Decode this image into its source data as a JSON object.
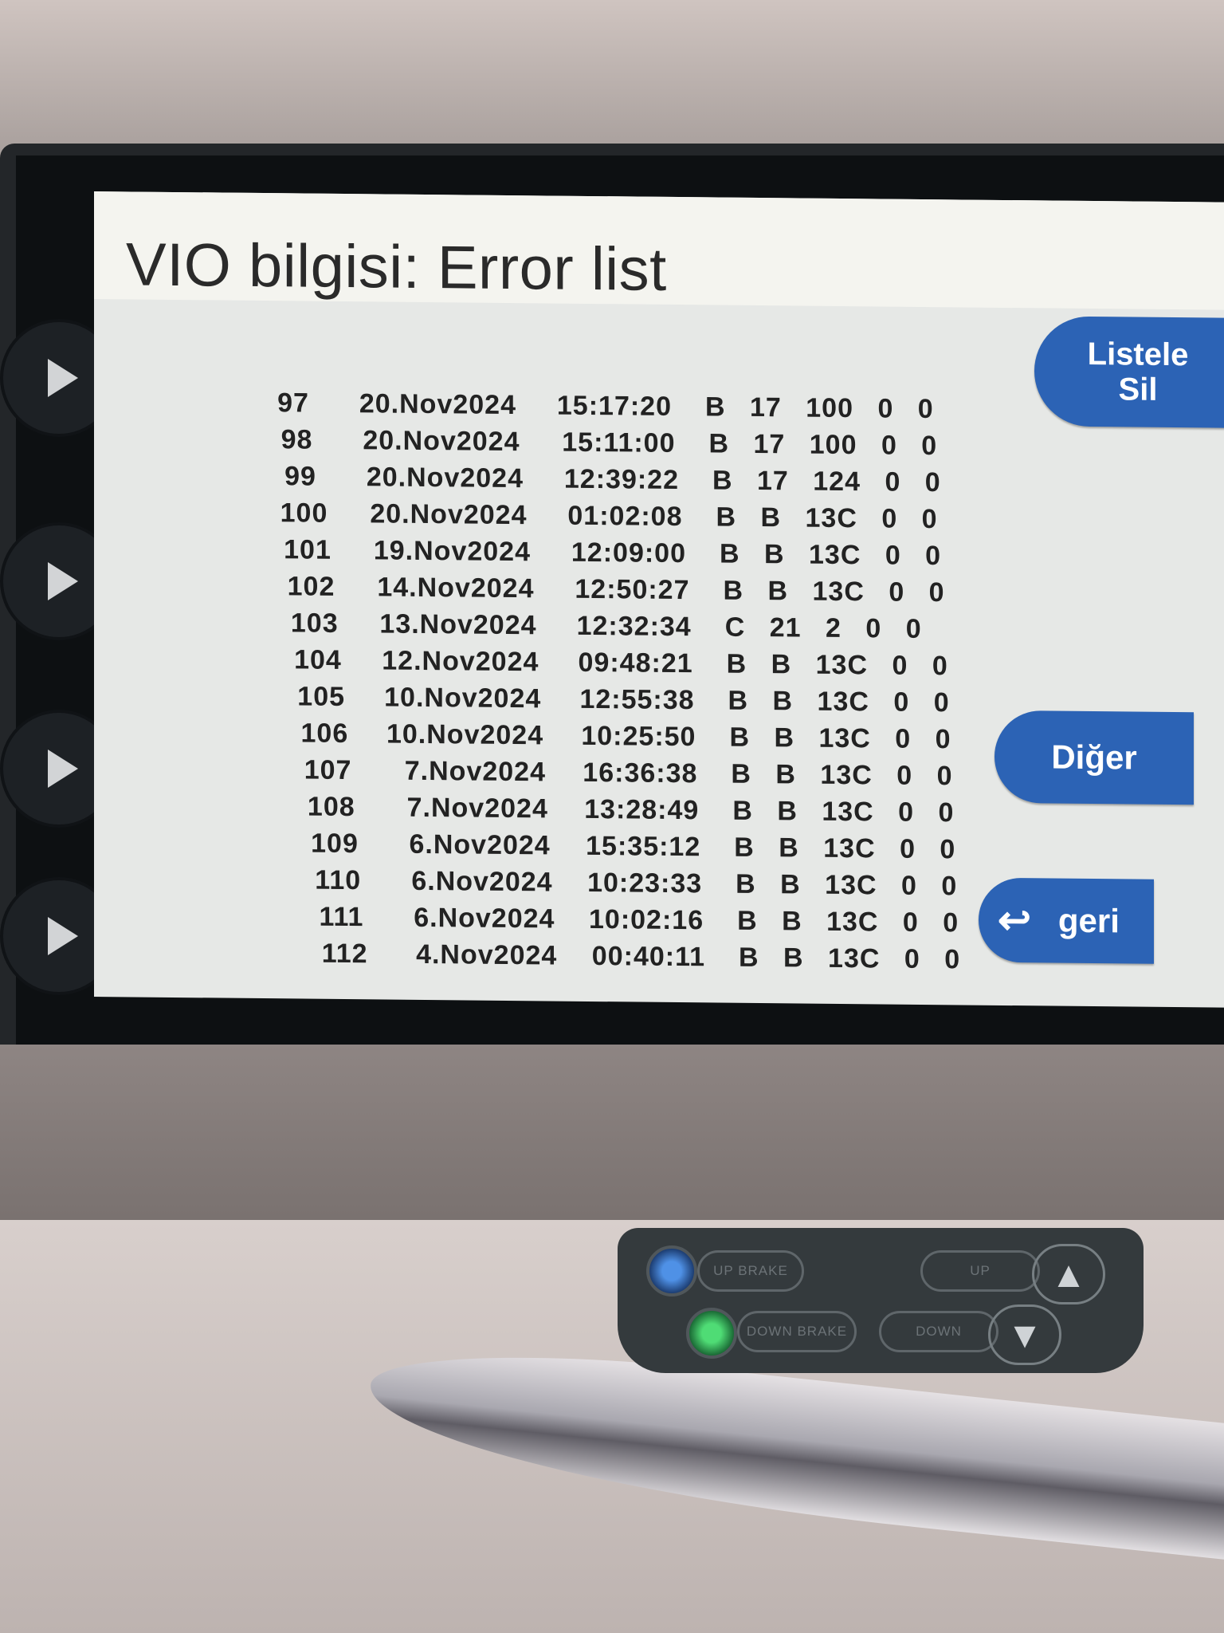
{
  "screen": {
    "title": "VIO bilgisi: Error list"
  },
  "error_list": [
    {
      "no": "97",
      "date": "20.Nov2024",
      "time": "15:17:20",
      "codes": "B 17 100 0 0"
    },
    {
      "no": "98",
      "date": "20.Nov2024",
      "time": "15:11:00",
      "codes": "B 17 100 0 0"
    },
    {
      "no": "99",
      "date": "20.Nov2024",
      "time": "12:39:22",
      "codes": "B 17 124 0 0"
    },
    {
      "no": "100",
      "date": "20.Nov2024",
      "time": "01:02:08",
      "codes": "B B 13C 0 0"
    },
    {
      "no": "101",
      "date": "19.Nov2024",
      "time": "12:09:00",
      "codes": "B B 13C 0 0"
    },
    {
      "no": "102",
      "date": "14.Nov2024",
      "time": "12:50:27",
      "codes": "B B 13C 0 0"
    },
    {
      "no": "103",
      "date": "13.Nov2024",
      "time": "12:32:34",
      "codes": "C 21 2 0 0"
    },
    {
      "no": "104",
      "date": "12.Nov2024",
      "time": "09:48:21",
      "codes": "B B 13C 0 0"
    },
    {
      "no": "105",
      "date": "10.Nov2024",
      "time": "12:55:38",
      "codes": "B B 13C 0 0"
    },
    {
      "no": "106",
      "date": "10.Nov2024",
      "time": "10:25:50",
      "codes": "B B 13C 0 0"
    },
    {
      "no": "107",
      "date": "7.Nov2024",
      "time": "16:36:38",
      "codes": "B B 13C 0 0"
    },
    {
      "no": "108",
      "date": "7.Nov2024",
      "time": "13:28:49",
      "codes": "B B 13C 0 0"
    },
    {
      "no": "109",
      "date": "6.Nov2024",
      "time": "15:35:12",
      "codes": "B B 13C 0 0"
    },
    {
      "no": "110",
      "date": "6.Nov2024",
      "time": "10:23:33",
      "codes": "B B 13C 0 0"
    },
    {
      "no": "111",
      "date": "6.Nov2024",
      "time": "10:02:16",
      "codes": "B B 13C 0 0"
    },
    {
      "no": "112",
      "date": "4.Nov2024",
      "time": "00:40:11",
      "codes": "B B 13C 0 0"
    }
  ],
  "buttons": {
    "list_line1": "Listele",
    "list_line2": "Sil",
    "other": "Diğer",
    "back": "geri",
    "back_icon": "return-arrow-icon"
  },
  "panel": {
    "up_brake": "UP BRAKE",
    "down_brake": "DOWN BRAKE",
    "up": "UP",
    "down": "DOWN"
  },
  "colors": {
    "button_blue": "#2c63b5",
    "screen_bg": "#e6e8e6",
    "led_blue": "#4f91e6",
    "led_green": "#4fdc75"
  }
}
